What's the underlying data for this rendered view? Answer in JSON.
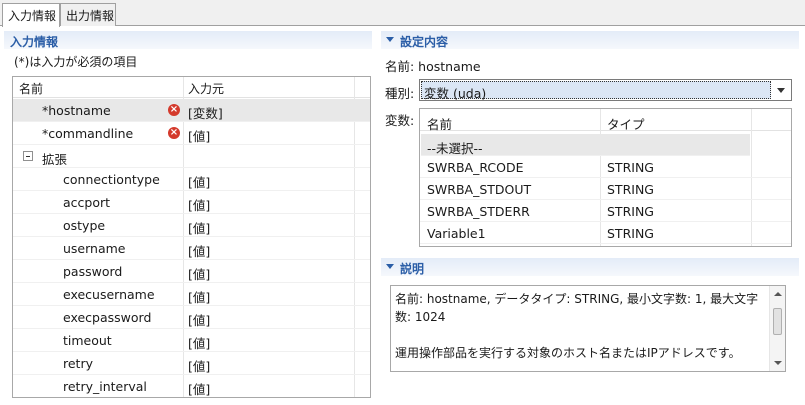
{
  "tabs": {
    "input": "入力情報",
    "output": "出力情報"
  },
  "left": {
    "title": "入力情報",
    "note": "(*)は入力が必須の項目",
    "columns": {
      "name": "名前",
      "source": "入力元"
    },
    "rows": [
      {
        "name": "*hostname",
        "source": "[変数]"
      },
      {
        "name": "*commandline",
        "source": "[値]"
      },
      {
        "name": "拡張",
        "source": ""
      },
      {
        "name": "connectiontype",
        "source": "[値]"
      },
      {
        "name": "accport",
        "source": "[値]"
      },
      {
        "name": "ostype",
        "source": "[値]"
      },
      {
        "name": "username",
        "source": "[値]"
      },
      {
        "name": "password",
        "source": "[値]"
      },
      {
        "name": "execusername",
        "source": "[値]"
      },
      {
        "name": "execpassword",
        "source": "[値]"
      },
      {
        "name": "timeout",
        "source": "[値]"
      },
      {
        "name": "retry",
        "source": "[値]"
      },
      {
        "name": "retry_interval",
        "source": "[値]"
      }
    ],
    "error_icon": "error-x-icon",
    "error_color": "#d43a2c"
  },
  "settings": {
    "title": "設定内容",
    "name_line": "名前: hostname",
    "type_label": "種別:",
    "type_value": "変数 (uda)",
    "var_label": "変数:",
    "var_columns": {
      "name": "名前",
      "type": "タイプ"
    },
    "var_rows": [
      {
        "name": "--未選択--",
        "type": ""
      },
      {
        "name": "SWRBA_RCODE",
        "type": "STRING"
      },
      {
        "name": "SWRBA_STDOUT",
        "type": "STRING"
      },
      {
        "name": "SWRBA_STDERR",
        "type": "STRING"
      },
      {
        "name": "Variable1",
        "type": "STRING"
      }
    ]
  },
  "description": {
    "title": "説明",
    "text": "名前: hostname, データタイプ: STRING, 最小文字数: 1, 最大文字数: 1024\n\n運用操作部品を実行する対象のホスト名またはIPアドレスです。"
  },
  "colors": {
    "section_title": "#2b5ea7",
    "selection": "#e8e8e8",
    "select_highlight": "#dbe6f5"
  }
}
